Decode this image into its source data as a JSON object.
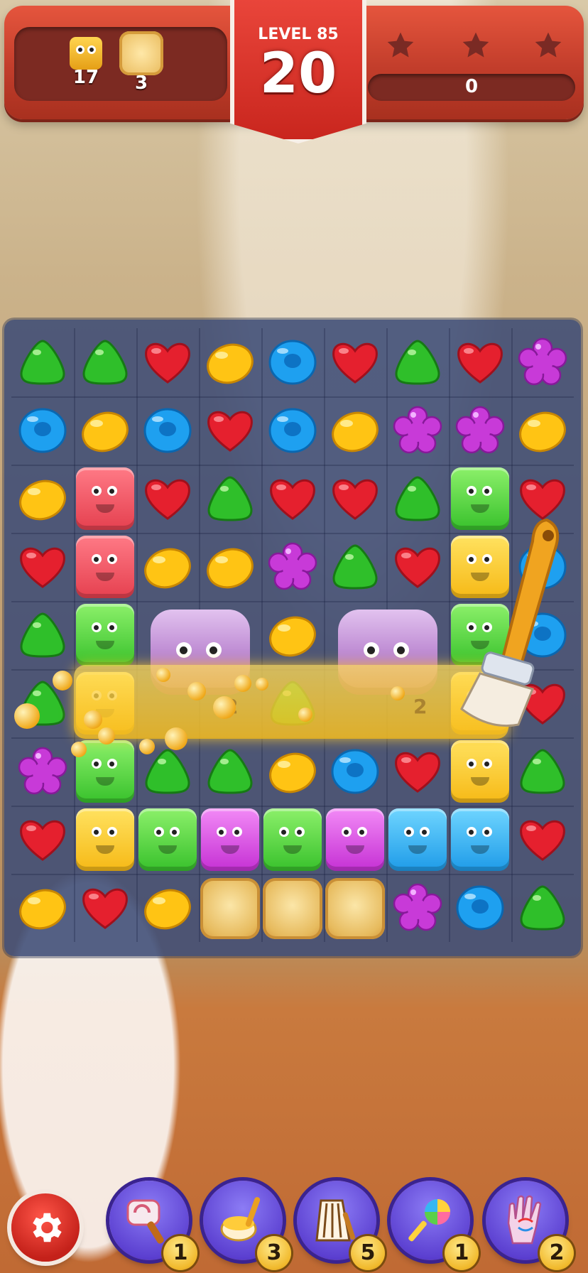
{
  "hud": {
    "level_label": "LEVEL 85",
    "moves_left": "20",
    "score": "0",
    "stars_total": 3,
    "stars_earned": 0,
    "goals": [
      {
        "icon": "jelly-block-icon",
        "count": "17"
      },
      {
        "icon": "biscuit-icon",
        "count": "3"
      }
    ]
  },
  "board": {
    "cols": 9,
    "rows": 9,
    "rows_data": [
      [
        "green-gumdrop",
        "green-gumdrop",
        "red-heart",
        "yellow-lemon",
        "blue-ring",
        "red-heart",
        "green-gumdrop",
        "red-heart",
        "purple-flower"
      ],
      [
        "blue-ring",
        "yellow-lemon",
        "blue-ring",
        "red-heart",
        "blue-ring",
        "yellow-lemon",
        "purple-flower",
        "purple-flower",
        "yellow-lemon"
      ],
      [
        "yellow-lemon",
        "red-jelly",
        "red-heart",
        "green-gumdrop",
        "red-heart",
        "red-heart",
        "green-gumdrop",
        "green-jelly",
        "red-heart"
      ],
      [
        "red-heart",
        "red-jelly",
        "yellow-lemon",
        "yellow-lemon",
        "purple-flower",
        "green-gumdrop",
        "red-heart",
        "yellow-jelly",
        "blue-ring"
      ],
      [
        "green-gumdrop",
        "green-jelly",
        "robot",
        "robot",
        "yellow-lemon",
        "robot",
        "robot",
        "green-jelly",
        "blue-ring"
      ],
      [
        "green-gumdrop",
        "yellow-jelly",
        "robot",
        "robot",
        "green-gumdrop",
        "robot",
        "robot",
        "yellow-jelly",
        "red-heart"
      ],
      [
        "purple-flower",
        "green-jelly",
        "green-gumdrop",
        "green-gumdrop",
        "yellow-lemon",
        "blue-ring",
        "red-heart",
        "yellow-jelly",
        "green-gumdrop"
      ],
      [
        "red-heart",
        "yellow-jelly",
        "green-jelly",
        "purple-jelly",
        "green-jelly",
        "purple-jelly",
        "blue-jelly",
        "blue-jelly",
        "red-heart"
      ],
      [
        "yellow-lemon",
        "red-heart",
        "yellow-lemon",
        "biscuit",
        "biscuit",
        "biscuit",
        "purple-flower",
        "blue-ring",
        "green-gumdrop"
      ]
    ],
    "blocker_hits": [
      "2",
      "2"
    ],
    "active_booster": "brush"
  },
  "bottom_bar": {
    "settings_icon": "gear-icon",
    "boosters": [
      {
        "icon": "hammer-icon",
        "count": "1"
      },
      {
        "icon": "brush-icon",
        "count": "3"
      },
      {
        "icon": "harp-icon",
        "count": "5"
      },
      {
        "icon": "lollipop-icon",
        "count": "1"
      },
      {
        "icon": "hand-swap-icon",
        "count": "2"
      }
    ]
  },
  "colors": {
    "hud_red": "#c23d2b",
    "board_bg": "#3e4c76",
    "red": "#e5202e",
    "yellow": "#ffc414",
    "green": "#2fbf2a",
    "blue": "#1ea0f0",
    "purple": "#c83ad8"
  }
}
